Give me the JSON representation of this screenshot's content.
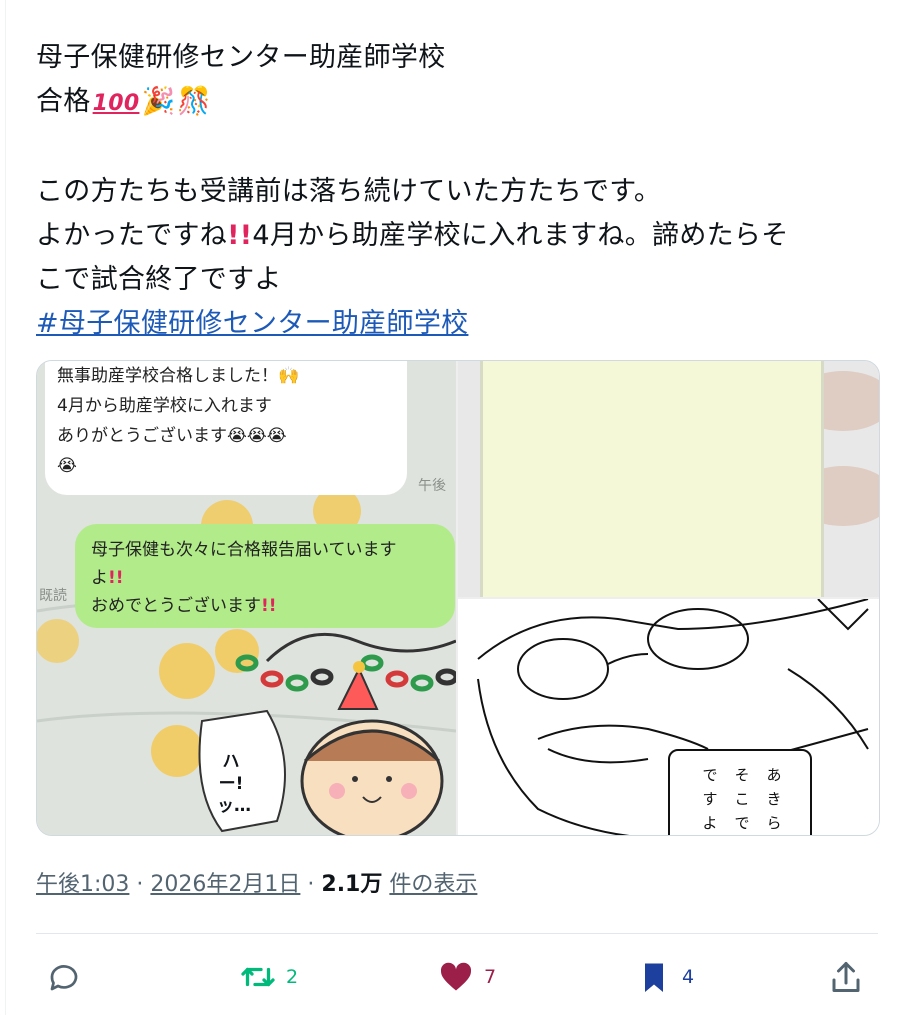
{
  "post": {
    "lines": [
      "母子保健研修センター助産師学校",
      "合格",
      "この方たちも受講前は落ち続けていた方たちです。",
      "よかったですね",
      "4月から助産学校に入れますね。諦めたらそ",
      "こで試合終了ですよ"
    ],
    "hashtag": "#母子保健研修センター助産師学校"
  },
  "media": {
    "left": {
      "white_bubble": [
        "無事助産学校合格しました！",
        "4月から助産学校に入れます",
        "ありがとうございます"
      ],
      "time": "午後",
      "green_bubble": [
        "母子保健も次々に合格報告届いています",
        "よ",
        "おめでとうございます"
      ],
      "read": "既読",
      "speech": "ハー!ッ…"
    },
    "bottom_right": {
      "col1": "あきら",
      "col2": "そこで",
      "col3": "ですよ"
    }
  },
  "meta": {
    "time": "午後1:03",
    "separator": "·",
    "date": "2026年2月1日",
    "views_number": "2.1万",
    "views_label": "件の表示"
  },
  "actions": {
    "reply_count": "",
    "repost_count": "2",
    "like_count": "7",
    "bookmark_count": "4"
  },
  "colors": {
    "repost": "#00ba7c",
    "like": "#9c1f4a",
    "bookmark": "#1d3f9e",
    "hashtag": "#1d5ab8"
  }
}
